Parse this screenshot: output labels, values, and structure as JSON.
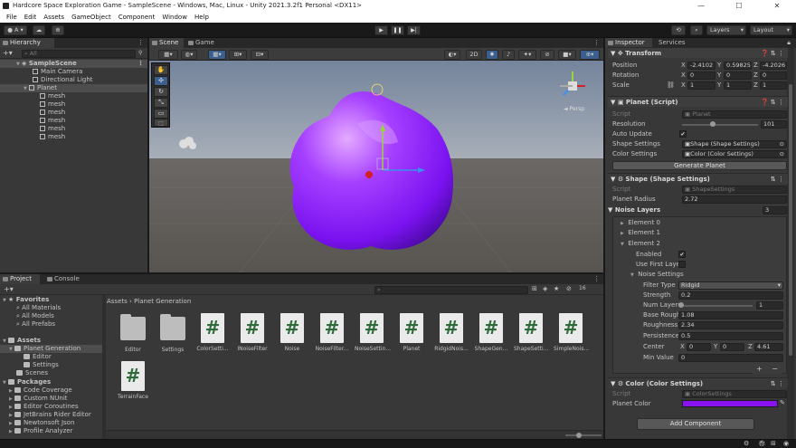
{
  "window": {
    "title": "Hardcore Space Exploration Game - SampleScene - Windows, Mac, Linux - Unity 2021.3.2f1 Personal <DX11>",
    "minimize": "—",
    "maximize": "☐",
    "close": "✕"
  },
  "menu": [
    "File",
    "Edit",
    "Assets",
    "GameObject",
    "Component",
    "Window",
    "Help"
  ],
  "toolbar": {
    "account": "A",
    "layers": "Layers",
    "layout": "Layout"
  },
  "hierarchy": {
    "tab": "Hierarchy",
    "search_placeholder": "All",
    "scene": "SampleScene",
    "items": [
      "Main Camera",
      "Directional Light",
      "Planet",
      "mesh",
      "mesh",
      "mesh",
      "mesh",
      "mesh",
      "mesh"
    ]
  },
  "scene_view": {
    "tab_scene": "Scene",
    "tab_game": "Game",
    "mode_2d": "2D",
    "persp": "◄ Persp"
  },
  "project": {
    "tab_project": "Project",
    "tab_console": "Console",
    "breadcrumb": [
      "Assets",
      "Planet Generation"
    ],
    "hidden_count": "16",
    "favorites": {
      "label": "Favorites",
      "items": [
        "All Materials",
        "All Models",
        "All Prefabs"
      ]
    },
    "assets": {
      "label": "Assets",
      "items": [
        "Planet Generation",
        "Editor",
        "Settings",
        "Scenes"
      ]
    },
    "packages": {
      "label": "Packages",
      "items": [
        "Code Coverage",
        "Custom NUnit",
        "Editor Coroutines",
        "JetBrains Rider Editor",
        "Newtonsoft Json",
        "Profile Analyzer"
      ]
    },
    "files": [
      {
        "name": "Editor",
        "kind": "folder"
      },
      {
        "name": "Settings",
        "kind": "folder"
      },
      {
        "name": "ColorSetti...",
        "kind": "script"
      },
      {
        "name": "INoiseFilter",
        "kind": "script"
      },
      {
        "name": "Noise",
        "kind": "script"
      },
      {
        "name": "NoiseFilter...",
        "kind": "script"
      },
      {
        "name": "NoiseSettin...",
        "kind": "script"
      },
      {
        "name": "Planet",
        "kind": "script"
      },
      {
        "name": "RidgidNois...",
        "kind": "script"
      },
      {
        "name": "ShapeGen...",
        "kind": "script"
      },
      {
        "name": "ShapeSetti...",
        "kind": "script"
      },
      {
        "name": "SimpleNois...",
        "kind": "script"
      },
      {
        "name": "TerrainFace",
        "kind": "script"
      }
    ],
    "script_glyph": "#"
  },
  "inspector": {
    "tab_inspector": "Inspector",
    "tab_services": "Services",
    "transform": {
      "title": "Transform",
      "position": {
        "label": "Position",
        "x": "-2.4102",
        "y": "0.59825",
        "z": "-4.2026"
      },
      "rotation": {
        "label": "Rotation",
        "x": "0",
        "y": "0",
        "z": "0"
      },
      "scale": {
        "label": "Scale",
        "x": "1",
        "y": "1",
        "z": "1"
      }
    },
    "planet_script": {
      "title": "Planet (Script)",
      "script_label": "Script",
      "script_value": "Planet",
      "resolution_label": "Resolution",
      "resolution": "101",
      "resolution_fraction": 0.4,
      "auto_update_label": "Auto Update",
      "auto_update": "✔",
      "shape_settings_label": "Shape Settings",
      "shape_settings": "Shape (Shape Settings)",
      "color_settings_label": "Color Settings",
      "color_settings": "Color (Color Settings)",
      "generate_button": "Generate Planet"
    },
    "shape_settings": {
      "title": "Shape (Shape Settings)",
      "script_label": "Script",
      "script_value": "ShapeSettings",
      "radius_label": "Planet Radius",
      "radius": "2.72",
      "noise_layers_label": "Noise Layers",
      "noise_layers": "3",
      "elements": [
        "Element 0",
        "Element 1",
        "Element 2"
      ],
      "enabled_label": "Enabled",
      "enabled": "✔",
      "use_first_label": "Use First Laye",
      "noise_settings_label": "Noise Settings",
      "filter_type_label": "Filter Type",
      "filter_type": "Ridgid",
      "strength_label": "Strength",
      "strength": "0.2",
      "num_layers_label": "Num Layers",
      "num_layers": "1",
      "num_layers_fraction": 0.0,
      "base_rough_label": "Base Rough",
      "base_rough": "1.08",
      "roughness_label": "Roughness",
      "roughness": "2.34",
      "persistence_label": "Persistence",
      "persistence": "0.5",
      "center_label": "Center",
      "center_x": "0",
      "center_y": "0",
      "center_z": "4.61",
      "min_value_label": "Min Value",
      "min_value": "0",
      "add": "+",
      "remove": "−"
    },
    "color_settings": {
      "title": "Color (Color Settings)",
      "script_label": "Script",
      "script_value": "ColorSettings",
      "planet_color_label": "Planet Color",
      "planet_color": "#8a11f0"
    },
    "add_component": "Add Component"
  },
  "colors": {
    "planet": "#8a11f0",
    "accent": "#3a79bb"
  }
}
